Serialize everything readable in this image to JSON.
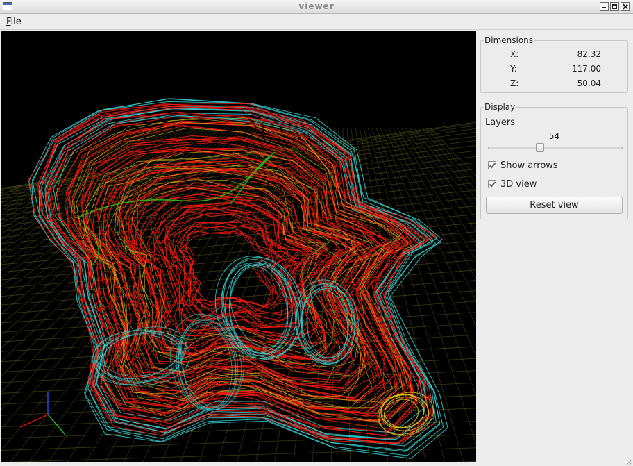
{
  "window": {
    "title": "viewer"
  },
  "menu": {
    "file": "File"
  },
  "dimensions": {
    "title": "Dimensions",
    "rows": [
      {
        "label": "X:",
        "value": "82.32"
      },
      {
        "label": "Y:",
        "value": "117.00"
      },
      {
        "label": "Z:",
        "value": "50.04"
      }
    ]
  },
  "display": {
    "title": "Display",
    "layers_label": "Layers",
    "layers_value": "54",
    "slider_fraction": 0.38,
    "show_arrows_label": "Show arrows",
    "show_arrows_checked": true,
    "view3d_label": "3D view",
    "view3d_checked": true,
    "reset_label": "Reset view"
  },
  "viewport": {
    "background": "#000000",
    "colors": {
      "grid": "#6b6b1e",
      "outer_contour": "#34d5d8",
      "inner_contour": "#ff1a10",
      "highlight": "#d9c21b",
      "accent": "#29c419"
    },
    "axis_colors": {
      "x": "#e01010",
      "y": "#2a46e0",
      "z": "#22b822"
    }
  }
}
